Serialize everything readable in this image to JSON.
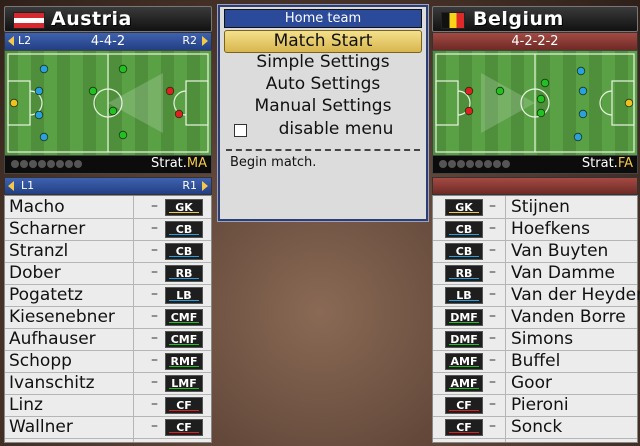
{
  "home": {
    "name": "Austria",
    "flag_colors": [
      "#d7282f",
      "#ffffff",
      "#d7282f"
    ],
    "left_btn": "L2",
    "right_btn": "R2",
    "formation": "4-4-2",
    "strat_prefix": "Strat.",
    "strat_code": "MA",
    "list_left": "L1",
    "list_right": "R1",
    "players": [
      {
        "name": "Macho",
        "pos": "GK"
      },
      {
        "name": "Scharner",
        "pos": "CB"
      },
      {
        "name": "Stranzl",
        "pos": "CB"
      },
      {
        "name": "Dober",
        "pos": "RB"
      },
      {
        "name": "Pogatetz",
        "pos": "LB"
      },
      {
        "name": "Kiesenebner",
        "pos": "CMF"
      },
      {
        "name": "Aufhauser",
        "pos": "CMF"
      },
      {
        "name": "Schopp",
        "pos": "RMF"
      },
      {
        "name": "Ivanschitz",
        "pos": "LMF"
      },
      {
        "name": "Linz",
        "pos": "CF"
      },
      {
        "name": "Wallner",
        "pos": "CF"
      }
    ]
  },
  "away": {
    "name": "Belgium",
    "flag_colors": [
      "#111111",
      "#f7d417",
      "#e02a2a"
    ],
    "formation": "4-2-2-2",
    "strat_prefix": "Strat.",
    "strat_code": "FA",
    "players": [
      {
        "name": "Stijnen",
        "pos": "GK"
      },
      {
        "name": "Hoefkens",
        "pos": "CB"
      },
      {
        "name": "Van Buyten",
        "pos": "CB"
      },
      {
        "name": "Van Damme",
        "pos": "RB"
      },
      {
        "name": "Van der Heyden",
        "pos": "LB"
      },
      {
        "name": "Vanden Borre",
        "pos": "DMF"
      },
      {
        "name": "Simons",
        "pos": "DMF"
      },
      {
        "name": "Buffel",
        "pos": "AMF"
      },
      {
        "name": "Goor",
        "pos": "AMF"
      },
      {
        "name": "Pieroni",
        "pos": "CF"
      },
      {
        "name": "Sonck",
        "pos": "CF"
      }
    ]
  },
  "menu": {
    "title": "Home team",
    "items": [
      "Match Start",
      "Simple Settings",
      "Auto Settings",
      "Manual Settings"
    ],
    "selected": 0,
    "checkbox_label": "disable menu",
    "help_text": "Begin match."
  },
  "colors": {
    "home_panel": "#2c4a8a",
    "away_panel": "#8b3a35",
    "selection": "#e8c95a",
    "marker_yellow": "#f0c020",
    "marker_blue": "#2aa0e0",
    "marker_green": "#22c022",
    "marker_red": "#e02020"
  }
}
